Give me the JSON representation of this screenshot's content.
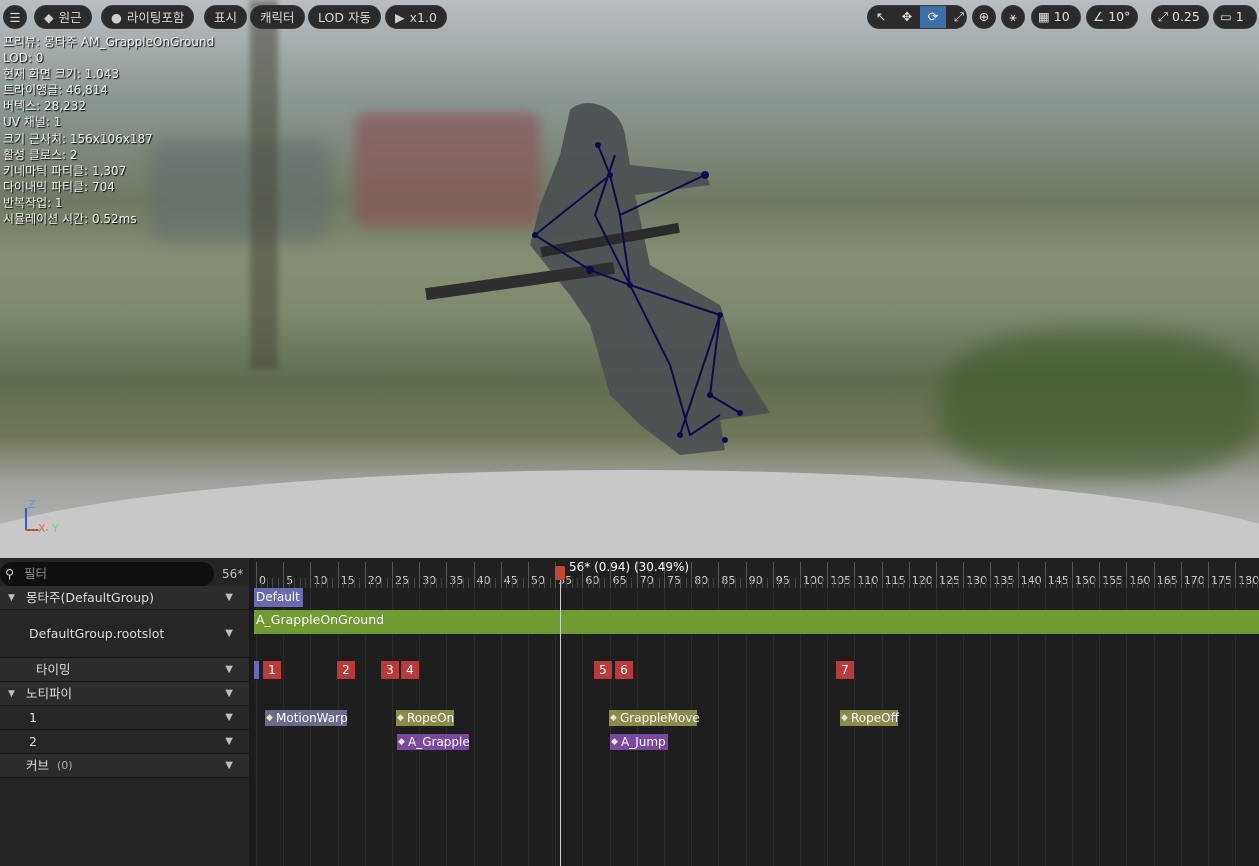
{
  "toolbar": {
    "perspective_label": "원근",
    "lighting_label": "라이팅포함",
    "show_label": "표시",
    "character_label": "캐릭터",
    "lod_label": "LOD 자동",
    "play_speed_label": "x1.0",
    "grid_value": "10",
    "angle_value": "10°",
    "scale_value": "0.25",
    "camera_value": "1"
  },
  "stats": [
    "프리뷰: 몽타주 AM_GrappleOnGround",
    "LOD: 0",
    "현재 화면 크기: 1.043",
    "트라이앵글: 46,814",
    "버텍스: 28,232",
    "UV 채널: 1",
    "크기 근사치: 156x106x187",
    "활성 클로스: 2",
    "키네마틱 파티클: 1,307",
    "다이내믹 파티클: 704",
    "반복작업: 1",
    "시뮬레이션 시간: 0.52ms"
  ],
  "axis": {
    "z": "Z",
    "x": "X",
    "y": "Y"
  },
  "timeline": {
    "filter_placeholder": "필터",
    "frame_count": "56*",
    "playhead_label": "56* (0.94) (30.49%)",
    "ticks": [
      "0",
      "5",
      "10",
      "15",
      "20",
      "25",
      "30",
      "35",
      "40",
      "45",
      "50",
      "55",
      "60",
      "65",
      "70",
      "75",
      "80",
      "85",
      "90",
      "95",
      "100",
      "105",
      "110",
      "115",
      "120",
      "125",
      "130",
      "135",
      "140",
      "145",
      "150",
      "155",
      "160",
      "165",
      "170",
      "175",
      "180"
    ],
    "tracks": {
      "montage_group": "몽타주(DefaultGroup)",
      "slot": "DefaultGroup.rootslot",
      "timing": "타이밍",
      "notifies": "노티파이",
      "notify_track_1": "1",
      "notify_track_2": "2",
      "curves": "커브",
      "curves_count": "(0)"
    },
    "section_label": "Default",
    "anim_segment": "A_GrappleOnGround",
    "markers": [
      "1",
      "2",
      "3",
      "4",
      "5",
      "6",
      "7"
    ],
    "notifies_row1": [
      "MotionWarp",
      "RopeOn",
      "GrappleMove",
      "RopeOff"
    ],
    "notifies_row2": [
      "A_Grapple",
      "A_Jump"
    ]
  }
}
